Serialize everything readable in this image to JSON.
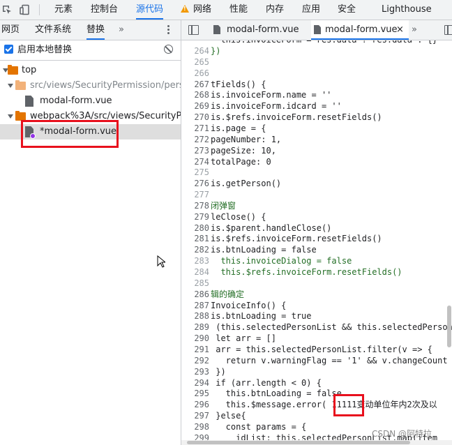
{
  "devtools_tabs": [
    "元素",
    "控制台",
    "源代码",
    "网络",
    "性能",
    "内存",
    "应用",
    "安全",
    "Lighthouse"
  ],
  "active_tab": "源代码",
  "left_panel": {
    "tabs": [
      "网页",
      "文件系统",
      "替换"
    ],
    "more": "»",
    "active_tab": "替换",
    "enable_overrides_label": "启用本地替换",
    "tree": {
      "root": "top",
      "folder1": "src/views/SecurityPermission/personM",
      "folder1_file": "modal-form.vue",
      "folder2": "webpack%3A/src/views/SecurityPermis",
      "folder2_file": "*modal-form.vue"
    }
  },
  "editor": {
    "tabs": [
      "modal-form.vue",
      "modal-form.vue"
    ],
    "close": "×",
    "more": "»",
    "lines": [
      {
        "n": "264",
        "t": "})"
      },
      {
        "n": "265",
        "t": ""
      },
      {
        "n": "266",
        "t": ""
      },
      {
        "n": "267",
        "t": "tFields() {"
      },
      {
        "n": "268",
        "t": "is.invoiceForm.name = ''"
      },
      {
        "n": "269",
        "t": "is.invoiceForm.idcard = ''"
      },
      {
        "n": "270",
        "t": "is.$refs.invoiceForm.resetFields()"
      },
      {
        "n": "271",
        "t": "is.page = {"
      },
      {
        "n": "272",
        "t": "pageNumber: 1,"
      },
      {
        "n": "273",
        "t": "pageSize: 10,"
      },
      {
        "n": "274",
        "t": "totalPage: 0"
      },
      {
        "n": "275",
        "t": ""
      },
      {
        "n": "276",
        "t": "is.getPerson()"
      },
      {
        "n": "277",
        "t": ""
      },
      {
        "n": "278",
        "t": "闭弹窗"
      },
      {
        "n": "279",
        "t": "leClose() {"
      },
      {
        "n": "280",
        "t": "is.$parent.handleClose()"
      },
      {
        "n": "281",
        "t": "is.$refs.invoiceForm.resetFields()"
      },
      {
        "n": "282",
        "t": "is.btnLoading = false"
      },
      {
        "n": "283",
        "t": "  this.invoiceDialog = false"
      },
      {
        "n": "284",
        "t": "  this.$refs.invoiceForm.resetFields()"
      },
      {
        "n": "285",
        "t": ""
      },
      {
        "n": "286",
        "t": "辑的确定"
      },
      {
        "n": "287",
        "t": "InvoiceInfo() {"
      },
      {
        "n": "288",
        "t": "is.btnLoading = true"
      },
      {
        "n": "289",
        "t": " (this.selectedPersonList && this.selectedPerson"
      },
      {
        "n": "290",
        "t": " let arr = []"
      },
      {
        "n": "291",
        "t": " arr = this.selectedPersonList.filter(v => {"
      },
      {
        "n": "292",
        "t": "   return v.warningFlag == '1' && v.changeCount"
      },
      {
        "n": "293",
        "t": " })"
      },
      {
        "n": "294",
        "t": " if (arr.length < 0) {"
      },
      {
        "n": "295",
        "t": "   this.btnLoading = false"
      },
      {
        "n": "296",
        "t": "   this.$message.error( 11111变动单位年内2次及以"
      },
      {
        "n": "297",
        "t": " }else{"
      },
      {
        "n": "298",
        "t": "   const params = {"
      },
      {
        "n": "299",
        "t": "     idList: this.selectedPersonList.map(item"
      }
    ],
    "top_partial": "  this.invoiceForm = res.data ? res.data : {}"
  },
  "watermark": "CSDN @阿特拉"
}
